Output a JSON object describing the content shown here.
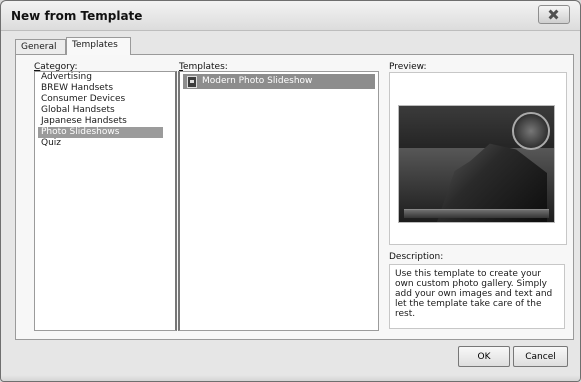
{
  "window": {
    "title": "New from Template"
  },
  "tabs": {
    "general": "General",
    "templates": "Templates"
  },
  "category": {
    "label_prefix": "C",
    "label_rest": "ategory:",
    "items": [
      "Advertising",
      "BREW Handsets",
      "Consumer Devices",
      "Global Handsets",
      "Japanese Handsets",
      "Photo Slideshows",
      "Quiz"
    ],
    "selected": "Photo Slideshows"
  },
  "templates": {
    "label_prefix": "T",
    "label_rest": "emplates:",
    "items": [
      "Modern Photo Slideshow"
    ]
  },
  "preview": {
    "label": "Preview:"
  },
  "description": {
    "label": "Description:",
    "text": "Use this template to create your own custom photo gallery. Simply add your own images and text and let the template take care of the rest."
  },
  "buttons": {
    "ok": "OK",
    "cancel": "Cancel"
  },
  "icons": {
    "close": "close-icon",
    "template": "document-icon"
  }
}
